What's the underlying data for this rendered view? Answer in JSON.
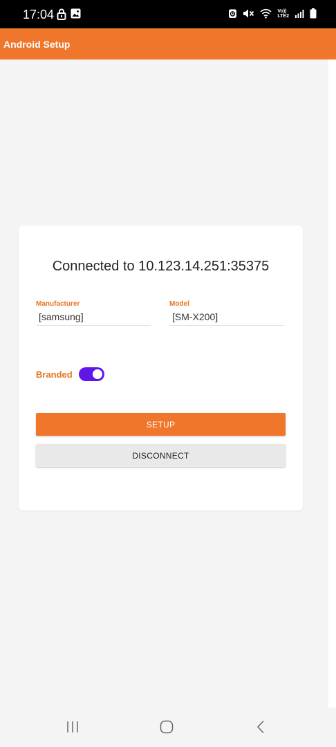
{
  "status_bar": {
    "time": "17:04",
    "left_icons": [
      "lock-icon",
      "image-icon"
    ],
    "right_icons": [
      "alarm-icon",
      "mute-icon",
      "wifi-icon",
      "volte-lte2-icon",
      "signal-icon",
      "battery-icon"
    ],
    "network_label_top": "Vo))",
    "network_label_bottom": "LTE2"
  },
  "app_bar": {
    "title": "Android Setup",
    "color": "#f0762c"
  },
  "card": {
    "connected_text": "Connected to 10.123.14.251:35375",
    "manufacturer": {
      "label": "Manufacturer",
      "value": "[samsung]"
    },
    "model": {
      "label": "Model",
      "value": "[SM-X200]"
    },
    "branded": {
      "label": "Branded",
      "checked": true,
      "toggle_color": "#6016e8"
    },
    "setup_label": "SETUP",
    "disconnect_label": "DISCONNECT"
  },
  "nav_bar": {
    "icons": [
      "recents-icon",
      "home-icon",
      "back-icon"
    ]
  }
}
